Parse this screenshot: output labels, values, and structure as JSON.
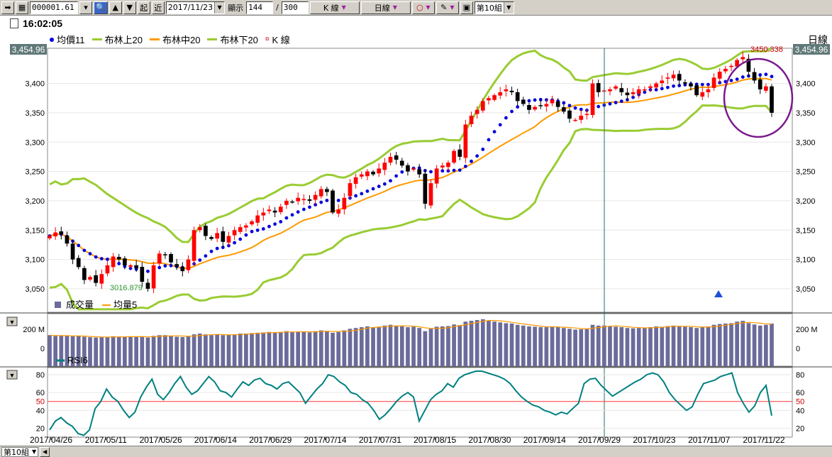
{
  "toolbar": {
    "symbol": "000001.61",
    "btn_start": "起",
    "btn_recent": "近",
    "date": "2017/11/23",
    "display_label": "顯示",
    "display_count": "144",
    "slash": "/",
    "total_count": "300",
    "kline_label": "K 線",
    "period_label": "日線",
    "group": "第10組"
  },
  "time": "16:02:05",
  "legend": {
    "avg_price": "均價11",
    "boll_up": "布林上20",
    "boll_mid": "布林中20",
    "boll_low": "布林下20",
    "kline": "K 線"
  },
  "period_right": "日線",
  "price_current": "3,454.96",
  "volume_legend": {
    "volume": "成交量",
    "ma5": "均量5"
  },
  "rsi_legend": "RSI6",
  "bottom": {
    "group_tab": "第10組"
  },
  "colors": {
    "up": "#ff0000",
    "down": "#000000",
    "bb": "#99cc33",
    "mid": "#ff9900",
    "dots": "#0000dd",
    "rsi": "#008080",
    "vol": "#6b6b9b"
  },
  "chart_data": [
    {
      "type": "candlestick",
      "title": "",
      "ylim": [
        3010,
        3460
      ],
      "y_ticks": [
        "3,050",
        "3,100",
        "3,150",
        "3,200",
        "3,250",
        "3,300",
        "3,350",
        "3,400"
      ],
      "x_ticks": [
        "2017/04/26",
        "2017/05/11",
        "2017/05/26",
        "2017/06/14",
        "2017/06/29",
        "2017/07/14",
        "2017/07/31",
        "2017/08/15",
        "2017/08/30",
        "2017/09/14",
        "2017/09/29",
        "2017/10/23",
        "2017/11/07",
        "2017/11/22"
      ],
      "close": [
        3140,
        3146,
        3143,
        3127,
        3100,
        3087,
        3065,
        3070,
        3060,
        3075,
        3090,
        3105,
        3100,
        3090,
        3090,
        3085,
        3062,
        3050,
        3090,
        3110,
        3108,
        3095,
        3088,
        3080,
        3100,
        3150,
        3155,
        3140,
        3135,
        3145,
        3130,
        3140,
        3150,
        3155,
        3158,
        3165,
        3175,
        3180,
        3185,
        3180,
        3190,
        3200,
        3198,
        3205,
        3203,
        3200,
        3210,
        3220,
        3215,
        3180,
        3185,
        3205,
        3230,
        3240,
        3245,
        3250,
        3245,
        3255,
        3265,
        3275,
        3270,
        3260,
        3250,
        3255,
        3245,
        3195,
        3230,
        3255,
        3260,
        3265,
        3285,
        3275,
        3330,
        3345,
        3355,
        3370,
        3375,
        3380,
        3385,
        3390,
        3385,
        3370,
        3365,
        3355,
        3360,
        3362,
        3365,
        3372,
        3360,
        3352,
        3340,
        3338,
        3345,
        3348,
        3400,
        3385,
        3388,
        3390,
        3395,
        3385,
        3380,
        3385,
        3390,
        3390,
        3395,
        3400,
        3405,
        3410,
        3415,
        3405,
        3400,
        3395,
        3380,
        3385,
        3390,
        3410,
        3420,
        3425,
        3430,
        3440,
        3445,
        3420,
        3405,
        3390,
        3395,
        3350
      ],
      "volume": [
        195,
        190,
        192,
        190,
        188,
        190,
        185,
        182,
        180,
        182,
        185,
        188,
        186,
        183,
        185,
        185,
        188,
        180,
        190,
        195,
        195,
        190,
        185,
        183,
        188,
        200,
        205,
        200,
        195,
        198,
        195,
        198,
        200,
        205,
        205,
        208,
        210,
        212,
        215,
        210,
        215,
        220,
        215,
        218,
        215,
        212,
        220,
        225,
        222,
        210,
        215,
        225,
        235,
        240,
        245,
        250,
        245,
        248,
        255,
        260,
        255,
        250,
        245,
        248,
        240,
        220,
        235,
        248,
        250,
        252,
        262,
        258,
        280,
        285,
        290,
        295,
        285,
        280,
        275,
        270,
        268,
        260,
        255,
        250,
        248,
        245,
        245,
        250,
        245,
        240,
        235,
        230,
        232,
        235,
        260,
        255,
        255,
        250,
        248,
        245,
        240,
        238,
        240,
        242,
        245,
        250,
        248,
        252,
        255,
        250,
        248,
        245,
        240,
        245,
        250,
        260,
        265,
        268,
        270,
        280,
        285,
        270,
        262,
        255,
        260,
        268
      ]
    },
    {
      "type": "line",
      "title": "",
      "series": [
        {
          "name": "RSI6",
          "values": [
            18,
            28,
            32,
            26,
            22,
            14,
            12,
            18,
            42,
            50,
            64,
            55,
            50,
            40,
            32,
            38,
            55,
            66,
            75,
            58,
            52,
            60,
            70,
            78,
            66,
            58,
            62,
            70,
            78,
            72,
            62,
            60,
            55,
            64,
            72,
            68,
            74,
            76,
            70,
            68,
            64,
            70,
            72,
            66,
            60,
            48,
            56,
            64,
            70,
            80,
            78,
            72,
            68,
            60,
            58,
            52,
            48,
            40,
            30,
            35,
            42,
            50,
            56,
            60,
            55,
            28,
            40,
            52,
            58,
            62,
            70,
            66,
            76,
            80,
            82,
            84,
            84,
            82,
            80,
            78,
            75,
            70,
            62,
            55,
            50,
            46,
            44,
            40,
            38,
            35,
            38,
            36,
            42,
            48,
            70,
            75,
            76,
            68,
            62,
            56,
            60,
            64,
            68,
            72,
            75,
            80,
            82,
            80,
            72,
            60,
            52,
            46,
            40,
            44,
            58,
            70,
            72,
            74,
            78,
            80,
            82,
            60,
            48,
            38,
            45,
            60,
            68,
            34
          ]
        }
      ],
      "ylim": [
        10,
        88
      ],
      "y_ticks": [
        "20",
        "40",
        "50",
        "60",
        "80"
      ]
    }
  ],
  "annotations": {
    "high_label": "3450.338",
    "low_label": "3016.879",
    "volume_axis_label": "200 M",
    "vol_zero": "0"
  }
}
